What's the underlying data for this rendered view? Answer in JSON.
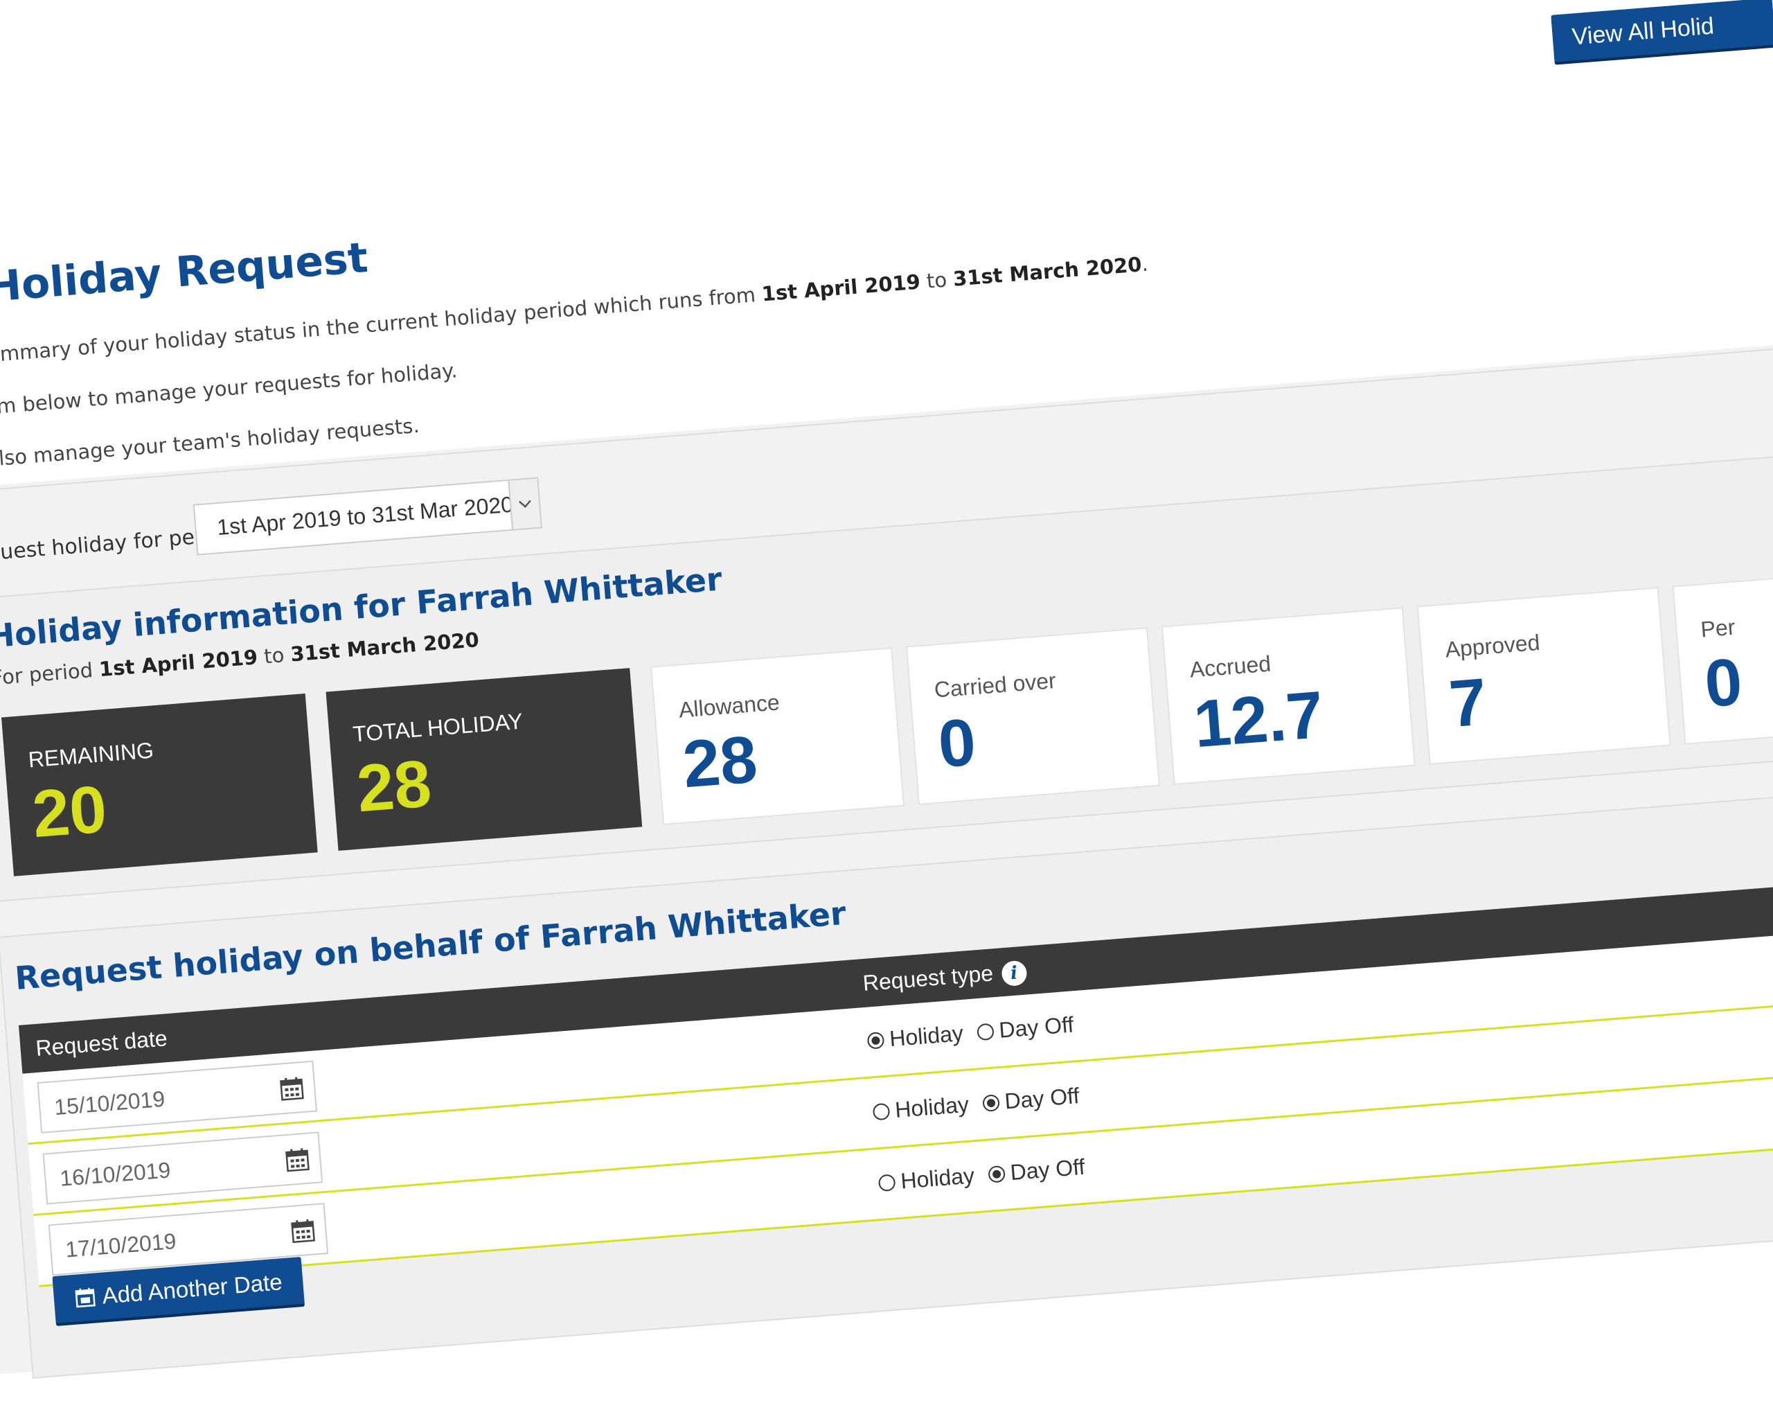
{
  "header": {
    "view_all_label": "View All Holid"
  },
  "page": {
    "title": "lew Holiday Request",
    "intro_line1_prefix": "ere is a summary of your holiday status in the current holiday period which runs from ",
    "intro_line1_start": "1st April 2019",
    "intro_line1_mid": " to ",
    "intro_line1_end": "31st March 2020",
    "intro_line1_suffix": ".",
    "intro_line2": "se the form below to manage your requests for holiday.",
    "intro_line3": "ou may also manage your team's holiday requests."
  },
  "period": {
    "label": "Request holiday for period",
    "selected": "1st Apr 2019 to 31st Mar 2020"
  },
  "info": {
    "title": "Holiday information for Farrah Whittaker",
    "sub_prefix": "For period ",
    "sub_start": "1st April 2019",
    "sub_mid": " to ",
    "sub_end": "31st March 2020",
    "stats": [
      {
        "label": "REMAINING",
        "value": "20"
      },
      {
        "label": "TOTAL HOLIDAY",
        "value": "28"
      },
      {
        "label": "Allowance",
        "value": "28"
      },
      {
        "label": "Carried over",
        "value": "0"
      },
      {
        "label": "Accrued",
        "value": "12.7"
      },
      {
        "label": "Approved",
        "value": "7"
      },
      {
        "label": "Per",
        "value": "0"
      }
    ]
  },
  "request": {
    "title": "Request holiday on behalf of Farrah Whittaker",
    "col_date": "Request date",
    "col_type": "Request type",
    "info_glyph": "i",
    "option_holiday": "Holiday",
    "option_dayoff": "Day Off",
    "rows": [
      {
        "date": "15/10/2019",
        "type": "Holiday"
      },
      {
        "date": "16/10/2019",
        "type": "Day Off"
      },
      {
        "date": "17/10/2019",
        "type": "Day Off"
      }
    ],
    "add_label": "Add Another Date"
  },
  "colors": {
    "brand_blue": "#0f4c92",
    "accent_yellow": "#d6e01e",
    "dark_tile": "#3a3a3a"
  },
  "icons": [
    "calendar-icon",
    "info-icon",
    "chevron-down-icon"
  ]
}
